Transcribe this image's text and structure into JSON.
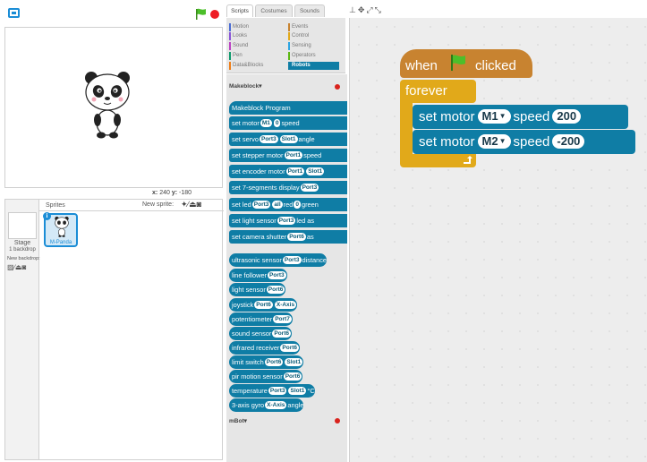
{
  "stage": {
    "mouse_x_label": "x:",
    "mouse_x": "240",
    "mouse_y_label": "y:",
    "mouse_y": "-180"
  },
  "sprite_pane": {
    "stage_label": "Stage",
    "backdrop_count": "1 backdrop",
    "new_backdrop_label": "New backdrop:",
    "sprites_label": "Sprites",
    "new_sprite_label": "New sprite:",
    "sprite_name": "M-Panda",
    "info_badge": "i"
  },
  "tabs": [
    {
      "label": "Scripts"
    },
    {
      "label": "Costumes"
    },
    {
      "label": "Sounds"
    }
  ],
  "categories": [
    {
      "label": "Motion",
      "color": "#4a6cd4"
    },
    {
      "label": "Looks",
      "color": "#8a55d7"
    },
    {
      "label": "Sound",
      "color": "#bb42c3"
    },
    {
      "label": "Pen",
      "color": "#0e9a6c"
    },
    {
      "label": "Data&Blocks",
      "color": "#ee7d16"
    },
    {
      "label": "Events",
      "color": "#c88330"
    },
    {
      "label": "Control",
      "color": "#e1a91a"
    },
    {
      "label": "Sensing",
      "color": "#2ca5e2"
    },
    {
      "label": "Operators",
      "color": "#5cb712"
    },
    {
      "label": "Robots",
      "color": "#0f7da5"
    }
  ],
  "palette": {
    "makeblock_heading": "Makeblock",
    "mbot_heading": "mBot",
    "heading_arrow": "▾",
    "blocks": [
      {
        "text": "Makeblock Program"
      },
      {
        "pre": "set motor",
        "c1": "M1",
        "mid": "speed",
        "c2": "0"
      },
      {
        "pre": "set servo",
        "c1": "Port3",
        "c2": "Slot1",
        "mid": "angle"
      },
      {
        "pre": "set stepper motor",
        "c1": "Port1",
        "mid": "speed"
      },
      {
        "pre": "set encoder motor",
        "c1": "Port1",
        "c2": "Slot1"
      },
      {
        "pre": "set 7-segments display",
        "c1": "Port3"
      },
      {
        "pre": "set led",
        "c1": "Port3",
        "c2": "all",
        "mid": "red",
        "c3": "0",
        "post": "green"
      },
      {
        "pre": "set light sensor",
        "c1": "Port3",
        "mid": "led as"
      },
      {
        "pre": "set camera shutter",
        "c1": "Port6",
        "mid": "as"
      },
      {
        "pre": "ultrasonic sensor",
        "c1": "Port3",
        "mid": "distance"
      },
      {
        "pre": "line follower",
        "c1": "Port3"
      },
      {
        "pre": "light sensor",
        "c1": "Port6"
      },
      {
        "pre": "joystick",
        "c1": "Port6",
        "c2": "X-Axis"
      },
      {
        "pre": "potentiometer",
        "c1": "Port7"
      },
      {
        "pre": "sound sensor",
        "c1": "Port6"
      },
      {
        "pre": "infrared receiver",
        "c1": "Port6"
      },
      {
        "pre": "limit switch",
        "c1": "Port6",
        "c2": "Slot1"
      },
      {
        "pre": "pir motion sensor",
        "c1": "Port6"
      },
      {
        "pre": "temperature",
        "c1": "Port3",
        "c2": "Slot1",
        "mid": "°C"
      },
      {
        "pre": "3-axis gyro",
        "c1": "X-Axis",
        "mid": "angle"
      }
    ]
  },
  "script": {
    "hat_when": "when",
    "hat_clicked": "clicked",
    "forever": "forever",
    "m1": {
      "pre": "set motor",
      "motor": "M1",
      "mid": "speed",
      "speed": "200"
    },
    "m2": {
      "pre": "set motor",
      "motor": "M2",
      "mid": "speed",
      "speed": "-200"
    }
  },
  "colors": {
    "accent": "#1b8dd6",
    "robots_block": "#0f7da5",
    "events_block": "#c88330",
    "control_block": "#e1a91a",
    "stop": "#ee1c24",
    "flag": "#4cbf2a"
  },
  "icons": [
    "fullscreen-icon",
    "green-flag-icon",
    "stop-icon",
    "paint-icon",
    "camera-icon",
    "upload-icon",
    "duplicate-icon",
    "delete-icon",
    "grow-icon",
    "shrink-icon"
  ]
}
